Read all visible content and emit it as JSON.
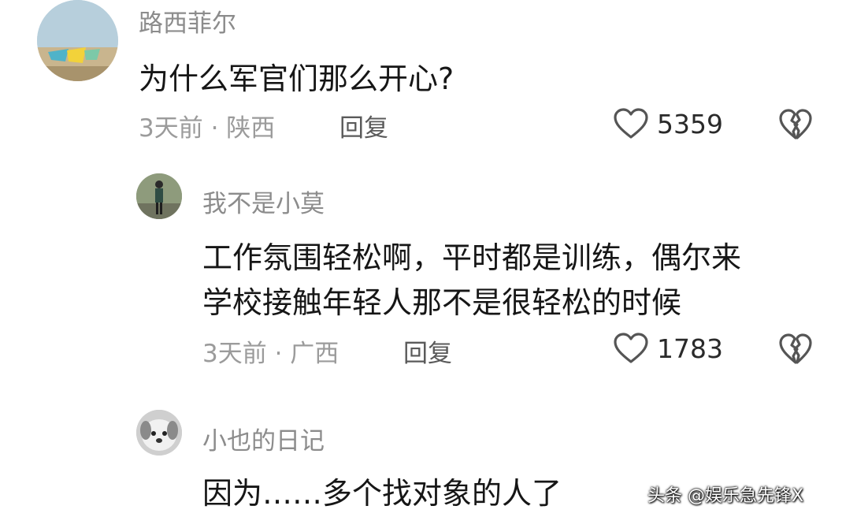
{
  "comments": [
    {
      "username": "路西菲尔",
      "text": "为什么军官们那么开心?",
      "meta": "3天前 · 陕西",
      "reply_label": "回复",
      "likes": "5359"
    },
    {
      "username": "我不是小莫",
      "text_line1": "工作氛围轻松啊，平时都是训练，偶尔来",
      "text_line2": "学校接触年轻人那不是很轻松的时候",
      "meta": "3天前 · 广西",
      "reply_label": "回复",
      "likes": "1783"
    },
    {
      "username": "小也的日记",
      "text": "因为……多个找对象的人了"
    }
  ],
  "watermark": "头条 @娱乐急先锋X",
  "icons": {
    "like": "heart-outline-icon",
    "dislike": "broken-heart-icon"
  },
  "colors": {
    "username": "#8c8c8c",
    "text": "#161616",
    "meta": "#9b9b9b",
    "reply": "#5a5a5a",
    "icon": "#555555"
  }
}
